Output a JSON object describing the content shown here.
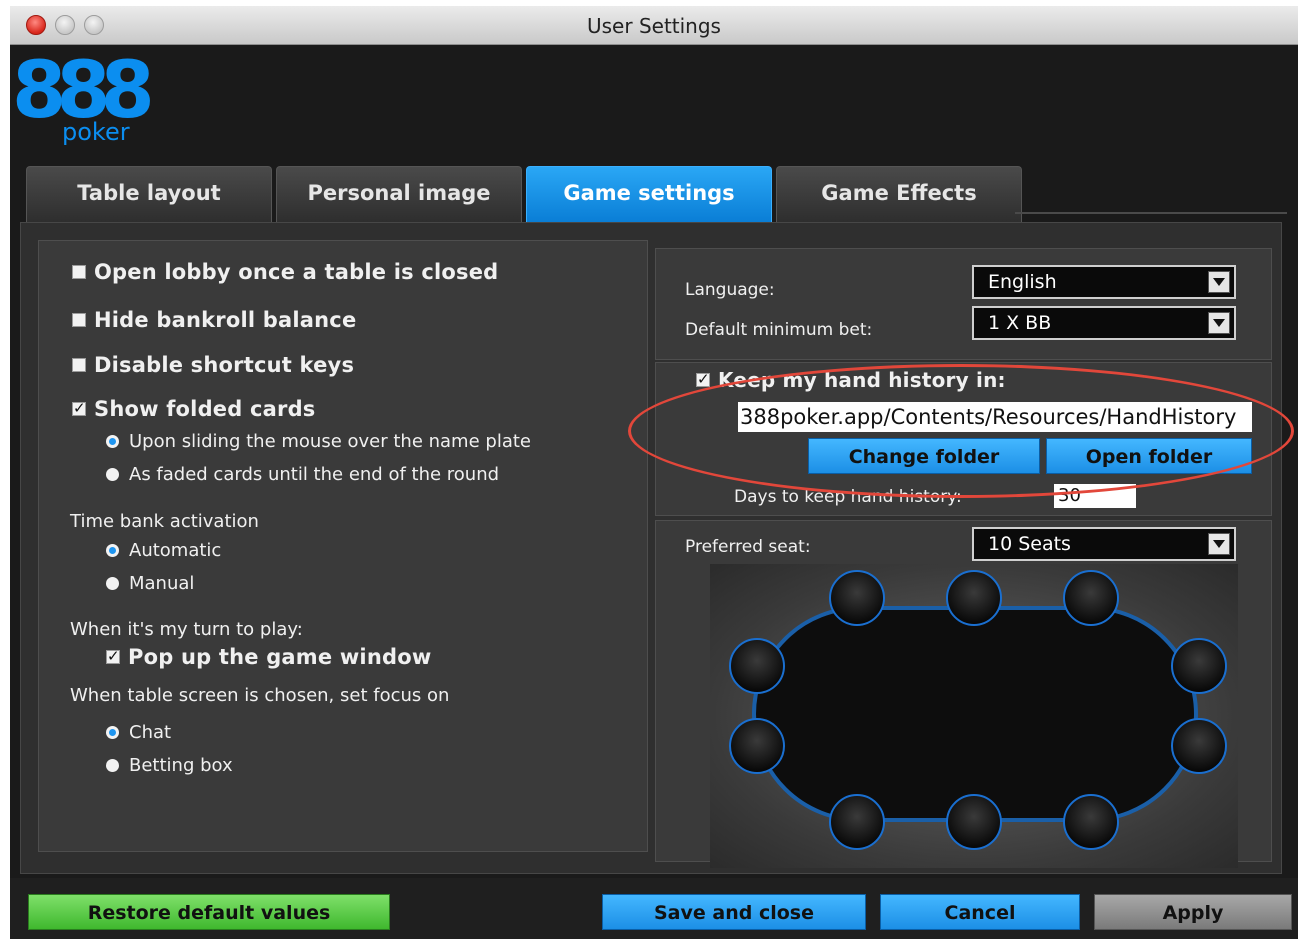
{
  "window": {
    "title": "User Settings"
  },
  "logo": {
    "digits": "888",
    "sub": "poker"
  },
  "tabs": [
    {
      "label": "Table layout"
    },
    {
      "label": "Personal image"
    },
    {
      "label": "Game settings"
    },
    {
      "label": "Game Effects"
    }
  ],
  "left": {
    "open_lobby": "Open lobby once a table is closed",
    "hide_bankroll": "Hide bankroll balance",
    "disable_shortcuts": "Disable shortcut keys",
    "show_folded": "Show folded cards",
    "folded_opt1": "Upon sliding the mouse over the name plate",
    "folded_opt2": "As faded cards until the end of the round",
    "timebank_label": "Time bank activation",
    "timebank_auto": "Automatic",
    "timebank_manual": "Manual",
    "my_turn_label": "When it's my turn to play:",
    "popup": "Pop up the game window",
    "focus_label": "When table screen is chosen, set focus on",
    "focus_chat": "Chat",
    "focus_betting": "Betting box"
  },
  "right": {
    "language_label": "Language:",
    "language_value": "English",
    "min_bet_label": "Default minimum bet:",
    "min_bet_value": "1 X BB",
    "keep_history": "Keep my hand history in:",
    "history_path": "388poker.app/Contents/Resources/HandHistory",
    "change_folder": "Change folder",
    "open_folder": "Open folder",
    "days_label": "Days to keep hand history:",
    "days_value": "30",
    "preferred_seat_label": "Preferred seat:",
    "seats_value": "10 Seats"
  },
  "footer": {
    "restore": "Restore default values",
    "save_close": "Save and close",
    "cancel": "Cancel",
    "apply": "Apply"
  },
  "colors": {
    "accent_blue": "#1e95f0",
    "restore_green": "#4fc23a",
    "annotation_red": "#e2473a"
  }
}
